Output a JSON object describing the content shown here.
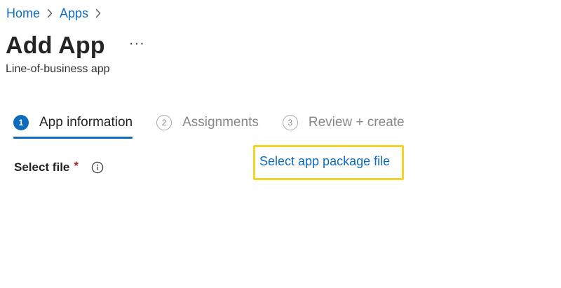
{
  "breadcrumb": {
    "items": [
      {
        "label": "Home"
      },
      {
        "label": "Apps"
      }
    ]
  },
  "header": {
    "title": "Add App",
    "more_label": "···",
    "subtitle": "Line-of-business app"
  },
  "steps": [
    {
      "number": "1",
      "label": "App information",
      "state": "active"
    },
    {
      "number": "2",
      "label": "Assignments",
      "state": "inactive"
    },
    {
      "number": "3",
      "label": "Review + create",
      "state": "inactive"
    }
  ],
  "form": {
    "select_file_label": "Select file",
    "required_mark": "*",
    "select_file_link": "Select app package file"
  },
  "colors": {
    "link": "#0f6cbd",
    "active_step": "#0f6cbd",
    "required": "#a4262c",
    "highlight": "#f5d327",
    "muted": "#8a8886"
  },
  "icons": {
    "breadcrumb_separator": "chevron-right-icon",
    "info": "info-icon",
    "more": "more-horizontal-icon"
  }
}
